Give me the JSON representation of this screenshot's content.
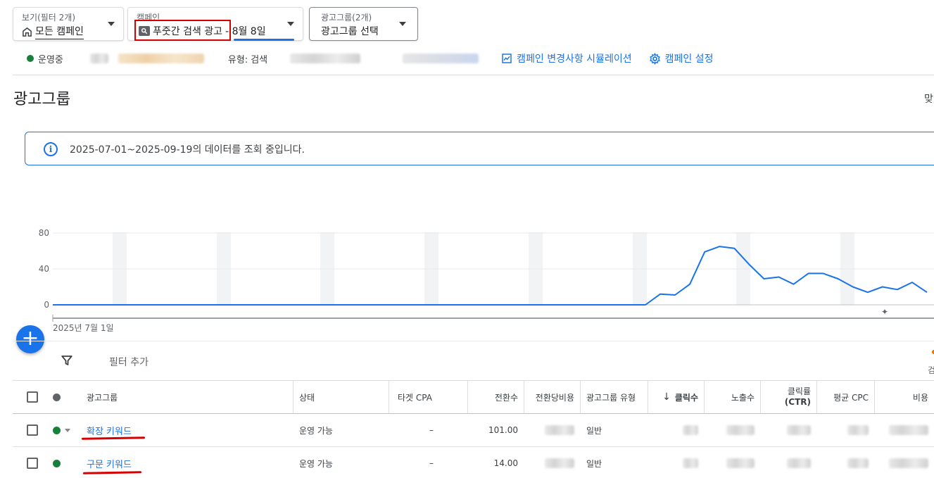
{
  "selectors": {
    "view": {
      "label": "보기(필터 2개)",
      "value": "모든 캠페인"
    },
    "campaign": {
      "label": "캠페인",
      "value": "푸줏간 검색 광고",
      "suffix": "- 8월 8일"
    },
    "adgroup": {
      "label": "광고그룹(2개)",
      "value": "광고그룹 선택"
    }
  },
  "status": {
    "state": "운영중",
    "type_label": "유형:",
    "type_value": "검색",
    "simulation_link": "캠페인 변경사항 시뮬레이션",
    "settings_link": "캠페인 설정"
  },
  "page": {
    "title": "광고그룹",
    "edge_text": "맞"
  },
  "banner": {
    "text": "2025-07-01~2025-09-19의 데이터를 조회 중입니다."
  },
  "chart_data": {
    "type": "line",
    "x_start_label": "2025년 7월 1일",
    "x_start": "2025-07-01",
    "x_end": "2025-09-19",
    "yticks": [
      0,
      40,
      80
    ],
    "ylim": [
      0,
      80
    ],
    "series": [
      {
        "color": "#1a73e8",
        "values": [
          0,
          0,
          0,
          0,
          0,
          0,
          0,
          0,
          0,
          0,
          0,
          0,
          0,
          0,
          0,
          0,
          0,
          0,
          0,
          0,
          0,
          0,
          0,
          0,
          0,
          0,
          0,
          0,
          0,
          0,
          0,
          0,
          0,
          0,
          0,
          0,
          0,
          0,
          0,
          0,
          0,
          12,
          11,
          23,
          59,
          65,
          63,
          45,
          29,
          31,
          23,
          35,
          35,
          29,
          20,
          14,
          20,
          17,
          25,
          14
        ]
      }
    ]
  },
  "fab": {
    "symbol": "+"
  },
  "filter": {
    "label": "필터 추가",
    "edge_text": "검"
  },
  "table": {
    "headers": {
      "adgroup": "광고그룹",
      "status": "상태",
      "target_cpa": "타겟 CPA",
      "conversions": "전환수",
      "cost_per_conv": "전환당비용",
      "type": "광고그룹 유형",
      "clicks_arrow": "↓",
      "clicks": "클릭수",
      "impressions": "노출수",
      "ctr": "클릭률",
      "ctr_sub": "(CTR)",
      "avg_cpc": "평균 CPC",
      "cost": "비용"
    },
    "rows": [
      {
        "name": "확장 키워드",
        "status": "운영 가능",
        "target_cpa": "–",
        "conversions": "101.00",
        "type": "일반"
      },
      {
        "name": "구문 키워드",
        "status": "운영 가능",
        "target_cpa": "–",
        "conversions": "14.00",
        "type": "일반"
      }
    ]
  }
}
